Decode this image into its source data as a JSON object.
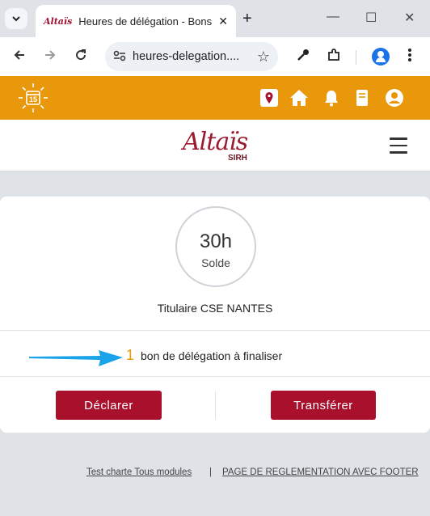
{
  "browser": {
    "tab_title": "Heures de délégation - Bons de",
    "tab_favicon_text": "Altaïs",
    "new_tab_label": "+",
    "window_controls": [
      "—",
      "☐",
      "✕"
    ],
    "url": "heures-delegation....",
    "icons": [
      "tab-search-icon",
      "back-icon",
      "forward-icon",
      "reload-icon",
      "site-info-icon",
      "star-icon",
      "eyedropper-icon",
      "extensions-icon",
      "profile-icon",
      "menu-kebab-icon"
    ]
  },
  "appbar": {
    "calendar_day": "15",
    "color": "#e8980a",
    "icons": [
      "map-pin-icon",
      "home-icon",
      "bell-icon",
      "book-icon",
      "user-icon"
    ]
  },
  "logo": {
    "main": "Altaïs",
    "sub": "SIRH",
    "color": "#9b1a2f"
  },
  "card": {
    "solde_value": "30h",
    "solde_label": "Solde",
    "titulaire": "Titulaire CSE NANTES",
    "bons_count": "1",
    "bons_text": "bon de délégation à finaliser",
    "declarer_label": "Déclarer",
    "transferer_label": "Transférer",
    "button_color": "#a8102c"
  },
  "footer": {
    "link1": "Test charte Tous modules",
    "separator": "|",
    "link2": "PAGE DE REGLEMENTATION AVEC FOOTER"
  }
}
